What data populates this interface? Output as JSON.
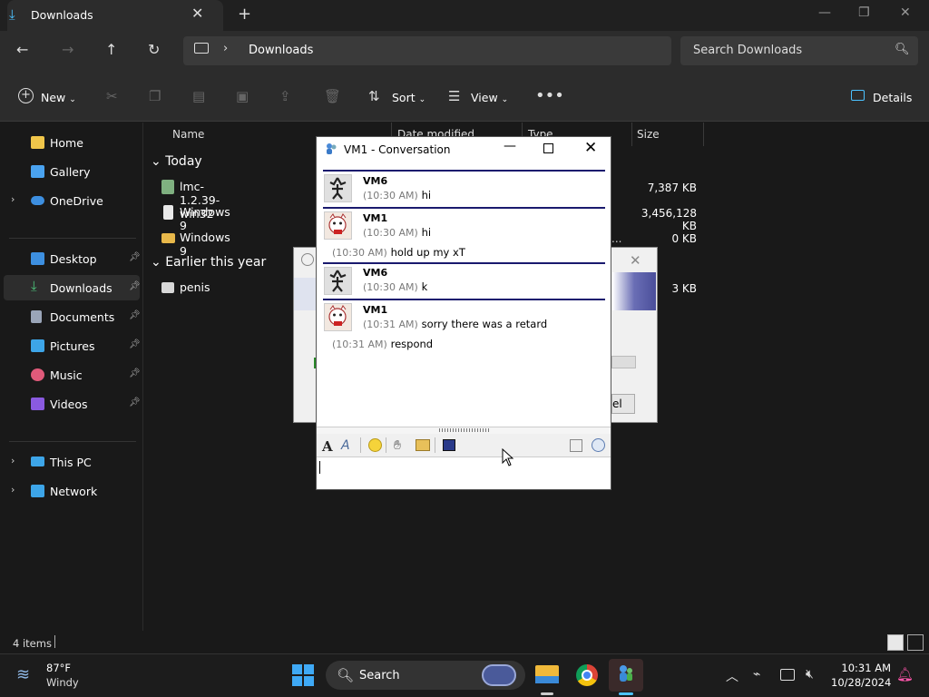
{
  "tab": {
    "title": "Downloads",
    "new_tab": "+",
    "close": "✕"
  },
  "window_controls": {
    "minimize": "—",
    "maximize": "❐",
    "close": "✕"
  },
  "address": {
    "separator": "›",
    "location": "Downloads"
  },
  "search": {
    "placeholder": "Search Downloads"
  },
  "commandbar": {
    "new_label": "New",
    "sort_label": "Sort",
    "view_label": "View",
    "more": "•••",
    "details_label": "Details"
  },
  "sidebar": {
    "items": [
      {
        "label": "Home",
        "color": "#f0c64a"
      },
      {
        "label": "Gallery",
        "color": "#4aa3f0"
      },
      {
        "label": "OneDrive",
        "color": "#3d8fe0"
      },
      {
        "label": "Desktop",
        "color": "#3d8fe0"
      },
      {
        "label": "Downloads",
        "color": "#4cc27a"
      },
      {
        "label": "Documents",
        "color": "#9aa5b8"
      },
      {
        "label": "Pictures",
        "color": "#3da5e8"
      },
      {
        "label": "Music",
        "color": "#e05a7a"
      },
      {
        "label": "Videos",
        "color": "#8a5ae0"
      },
      {
        "label": "This PC",
        "color": "#3da5e8"
      },
      {
        "label": "Network",
        "color": "#3da5e8"
      }
    ]
  },
  "filelist": {
    "columns": {
      "name": "Name",
      "date": "Date modified",
      "type": "Type",
      "size": "Size"
    },
    "groups": [
      {
        "label": "Today"
      },
      {
        "label": "Earlier this year"
      }
    ],
    "files": [
      {
        "name": "lmc-1.2.39-win32",
        "size": "7,387 KB"
      },
      {
        "name": "Windows 9",
        "size": "3,456,128 KB"
      },
      {
        "name": "Windows 9",
        "type_fragment": "...",
        "size": "0 KB"
      },
      {
        "name": "penis",
        "size": "3 KB"
      }
    ]
  },
  "bg_dialog": {
    "cancel_fragment": "el"
  },
  "conversation": {
    "title": "VM1 - Conversation",
    "messages": [
      {
        "sender": "VM6",
        "lines": [
          {
            "time": "(10:30 AM)",
            "text": "hi"
          }
        ]
      },
      {
        "sender": "VM1",
        "lines": [
          {
            "time": "(10:30 AM)",
            "text": "hi"
          },
          {
            "time": "(10:30 AM)",
            "text": "hold up my xT"
          }
        ]
      },
      {
        "sender": "VM6",
        "lines": [
          {
            "time": "(10:30 AM)",
            "text": "k"
          }
        ]
      },
      {
        "sender": "VM1",
        "lines": [
          {
            "time": "(10:31 AM)",
            "text": "sorry there was a retard"
          },
          {
            "time": "(10:31 AM)",
            "text": "respond"
          }
        ]
      }
    ]
  },
  "status": {
    "items": "4 items"
  },
  "taskbar": {
    "weather_temp": "87°F",
    "weather_cond": "Windy",
    "search_label": "Search",
    "clock_time": "10:31 AM",
    "clock_date": "10/28/2024"
  }
}
